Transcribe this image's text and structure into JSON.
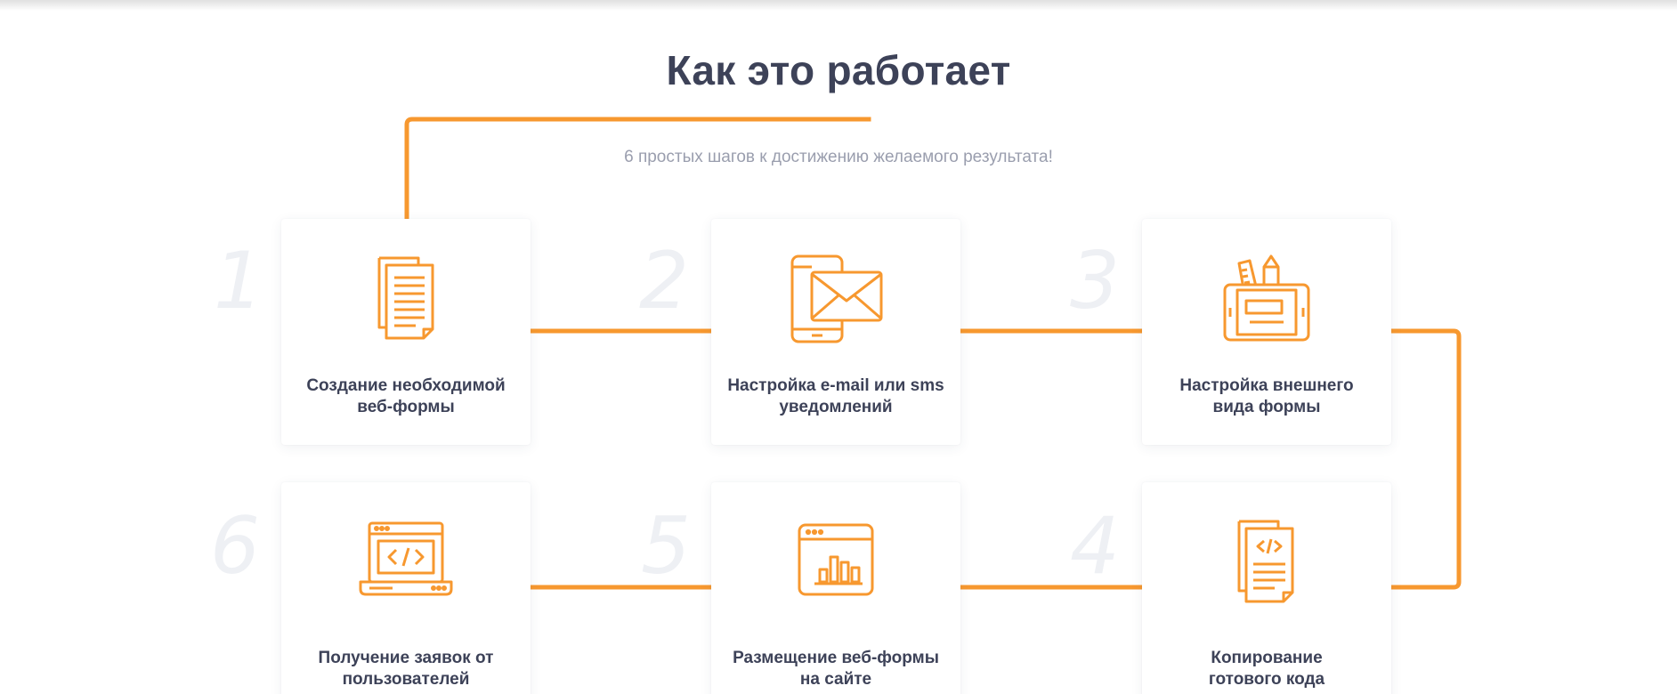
{
  "section": {
    "title": "Как это работает",
    "subtitle": "6 простых шагов к достижению желаемого результата!"
  },
  "colors": {
    "accent": "#f7982f",
    "title": "#3d4258",
    "subtitle": "#9a9eae",
    "step_number": "#eef0f4"
  },
  "steps": [
    {
      "number": "1",
      "label": "Создание необходимой\nвеб-формы",
      "icon": "document-icon"
    },
    {
      "number": "2",
      "label": "Настройка e-mail или sms\nуведомлений",
      "icon": "phone-envelope-icon"
    },
    {
      "number": "3",
      "label": "Настройка внешнего\nвида формы",
      "icon": "design-tools-tablet-icon"
    },
    {
      "number": "4",
      "label": "Копирование\nготового кода",
      "icon": "code-document-icon"
    },
    {
      "number": "5",
      "label": "Размещение веб-формы\nна сайте",
      "icon": "browser-chart-icon"
    },
    {
      "number": "6",
      "label": "Получение заявок от\nпользователей",
      "icon": "laptop-code-icon"
    }
  ]
}
